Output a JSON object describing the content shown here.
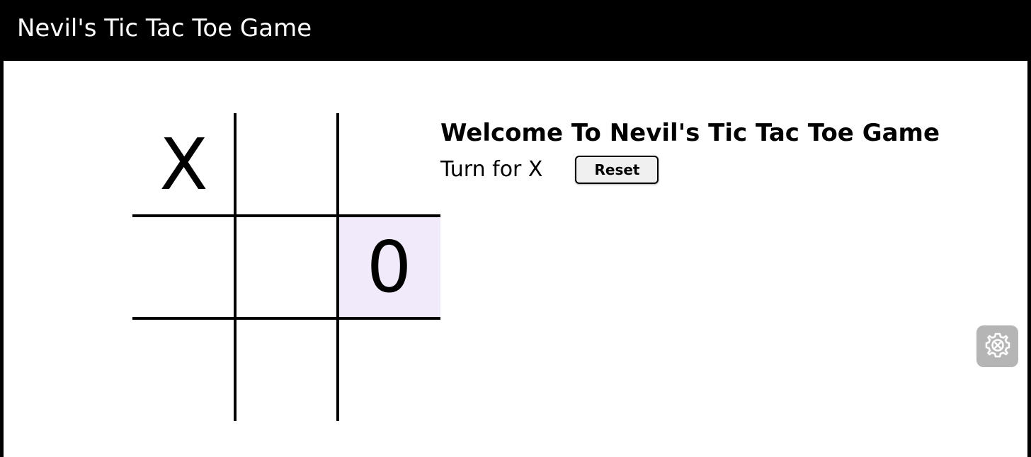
{
  "window": {
    "title": "Nevil's Tic Tac Toe Game"
  },
  "game": {
    "heading": "Welcome To Nevil's Tic Tac Toe Game",
    "turn_text": "Turn for X",
    "reset_label": "Reset",
    "board": [
      "X",
      "",
      "",
      "",
      "",
      "0",
      "",
      "",
      ""
    ],
    "highlighted_cell": 5
  },
  "floating_button": {
    "icon": "gear-icon"
  },
  "colors": {
    "titlebar_bg": "#000000",
    "page_bg": "#ffffff",
    "highlight_cell": "#f1eafb",
    "floating_button_bg": "#b5b5b5"
  }
}
